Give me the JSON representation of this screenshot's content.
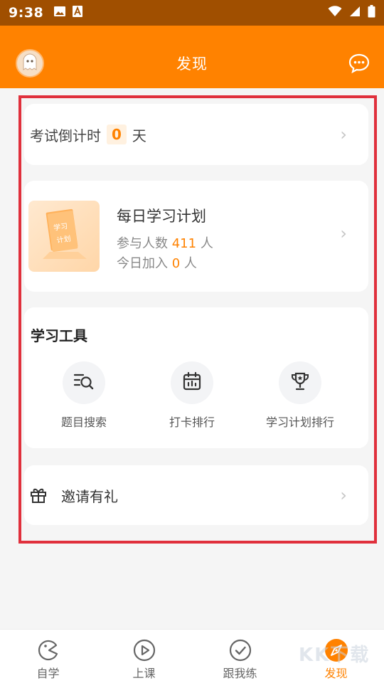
{
  "status_bar": {
    "time": "9:38"
  },
  "header": {
    "title": "发现",
    "avatar_icon": "ghost-avatar-icon",
    "message_icon": "chat-bubble-icon"
  },
  "countdown": {
    "label": "考试倒计时",
    "days": "0",
    "unit": "天"
  },
  "daily_plan": {
    "title": "每日学习计划",
    "participants_label": "参与人数",
    "participants": "411",
    "participants_unit": "人",
    "joined_label": "今日加入",
    "joined": "0",
    "joined_unit": "人",
    "thumb_text": [
      "学习",
      "计划"
    ]
  },
  "tools": {
    "title": "学习工具",
    "items": [
      {
        "label": "题目搜索",
        "icon": "search-list-icon"
      },
      {
        "label": "打卡排行",
        "icon": "calendar-icon"
      },
      {
        "label": "学习计划排行",
        "icon": "trophy-icon"
      }
    ]
  },
  "invite": {
    "label": "邀请有礼",
    "icon": "gift-icon"
  },
  "tabs": [
    {
      "label": "自学",
      "icon": "pacman-icon",
      "active": false
    },
    {
      "label": "上课",
      "icon": "play-icon",
      "active": false
    },
    {
      "label": "跟我练",
      "icon": "check-circle-icon",
      "active": false
    },
    {
      "label": "发现",
      "icon": "compass-icon",
      "active": true
    }
  ],
  "watermark": "KK下载",
  "colors": {
    "primary": "#ff8200",
    "status_bar": "#a04f00",
    "highlight": "#e0303c",
    "background": "#f5f5f5"
  }
}
